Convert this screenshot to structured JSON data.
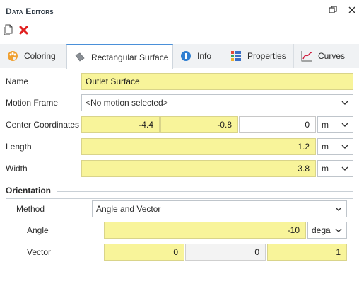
{
  "window": {
    "title": "Data Editors"
  },
  "toolbar": {
    "new_icon": "new-document-icon",
    "delete_icon": "delete-x-icon"
  },
  "tabs": [
    {
      "label": "Coloring",
      "icon": "palette-icon"
    },
    {
      "label": "Rectangular Surface",
      "icon": "surface-icon"
    },
    {
      "label": "Info",
      "icon": "info-icon"
    },
    {
      "label": "Properties",
      "icon": "properties-icon"
    },
    {
      "label": "Curves",
      "icon": "curves-icon"
    }
  ],
  "form": {
    "name": {
      "label": "Name",
      "value": "Outlet Surface"
    },
    "motion_frame": {
      "label": "Motion Frame",
      "value": "<No motion selected>"
    },
    "center": {
      "label": "Center Coordinates",
      "x": "-4.4",
      "y": "-0.8",
      "z": "0",
      "unit": "m"
    },
    "length": {
      "label": "Length",
      "value": "1.2",
      "unit": "m"
    },
    "width": {
      "label": "Width",
      "value": "3.8",
      "unit": "m"
    }
  },
  "orientation": {
    "title": "Orientation",
    "method": {
      "label": "Method",
      "value": "Angle and Vector"
    },
    "angle": {
      "label": "Angle",
      "value": "-10",
      "unit": "dega"
    },
    "vector": {
      "label": "Vector",
      "x": "0",
      "y": "0",
      "z": "1"
    }
  },
  "colors": {
    "accent": "#4a90d9",
    "input_highlight": "#f8f49a",
    "delete": "#e02020"
  }
}
